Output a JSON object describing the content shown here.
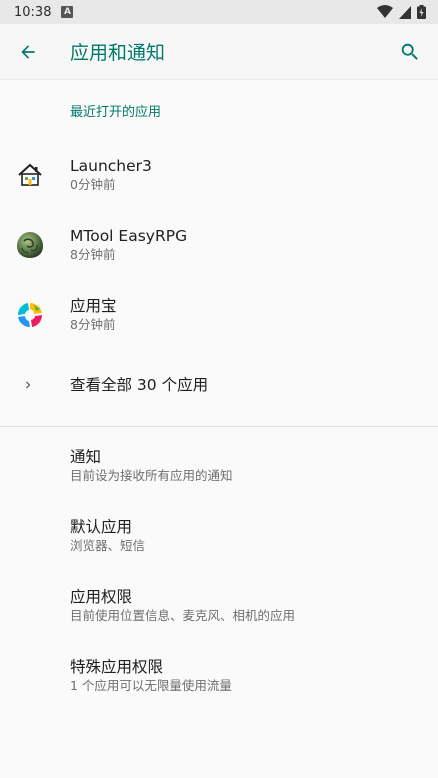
{
  "status_bar": {
    "time": "10:38",
    "notification_letter": "A"
  },
  "app_bar": {
    "title": "应用和通知"
  },
  "recent": {
    "header": "最近打开的应用",
    "apps": [
      {
        "name": "Launcher3",
        "time": "0分钟前",
        "icon": "house-icon"
      },
      {
        "name": "MTool EasyRPG",
        "time": "8分钟前",
        "icon": "rock-icon"
      },
      {
        "name": "应用宝",
        "time": "8分钟前",
        "icon": "yingyongbao-icon"
      }
    ],
    "see_all": "查看全部 30 个应用"
  },
  "prefs": [
    {
      "title": "通知",
      "summary": "目前设为接收所有应用的通知"
    },
    {
      "title": "默认应用",
      "summary": "浏览器、短信"
    },
    {
      "title": "应用权限",
      "summary": "目前使用位置信息、麦克风、相机的应用"
    },
    {
      "title": "特殊应用权限",
      "summary": "1 个应用可以无限量使用流量"
    }
  ],
  "colors": {
    "accent": "#00796b",
    "background": "#fafafa"
  }
}
